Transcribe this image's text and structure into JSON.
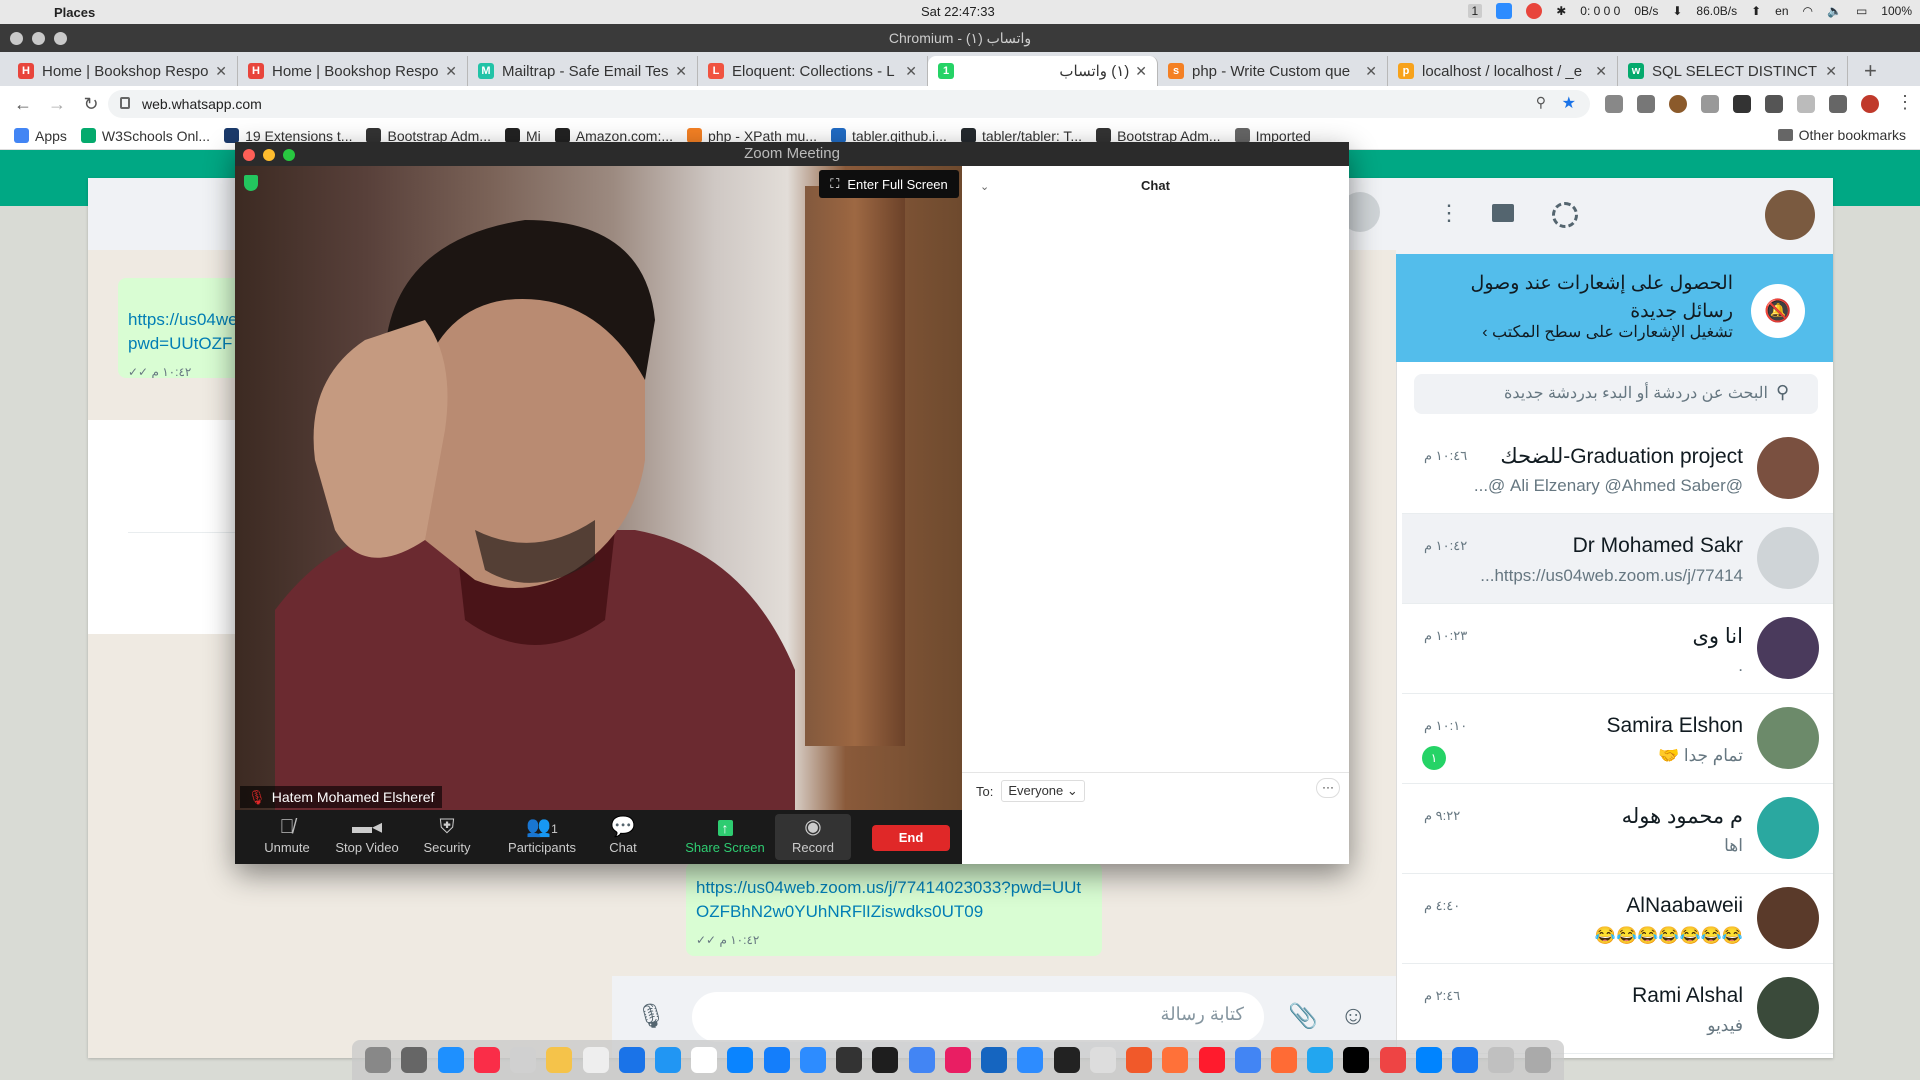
{
  "menubar": {
    "app_name": "Places",
    "clock": "Sat 22:47:33",
    "net_down": "0B/s",
    "net_up": "86.0B/s",
    "counter": "0: 0 0 0",
    "lang": "en",
    "battery": "100%",
    "badge": "1"
  },
  "browser": {
    "window_title": "Chromium - واتساب (١)",
    "tabs": [
      {
        "label": "Home | Bookshop Respo",
        "color": "#e8453c",
        "glyph": "H"
      },
      {
        "label": "Home | Bookshop Respo",
        "color": "#e8453c",
        "glyph": "H"
      },
      {
        "label": "Mailtrap - Safe Email Tes",
        "color": "#22c3a7",
        "glyph": "M"
      },
      {
        "label": "Eloquent: Collections - L",
        "color": "#f05340",
        "glyph": "L"
      },
      {
        "label": "(١) واتساب",
        "color": "#25d366",
        "glyph": "1"
      },
      {
        "label": "php - Write Custom que",
        "color": "#f48024",
        "glyph": "s"
      },
      {
        "label": "localhost / localhost / _e",
        "color": "#f7a21b",
        "glyph": "p"
      },
      {
        "label": "SQL SELECT DISTINCT S",
        "color": "#04aa6d",
        "glyph": "w"
      }
    ],
    "url": "web.whatsapp.com",
    "bookmarks": [
      {
        "label": "Apps",
        "color": "#4285f4"
      },
      {
        "label": "W3Schools Onl...",
        "color": "#04aa6d"
      },
      {
        "label": "19 Extensions t...",
        "color": "#1b3a6b"
      },
      {
        "label": "Bootstrap Adm...",
        "color": "#333333"
      },
      {
        "label": "Mi",
        "color": "#222222"
      },
      {
        "label": "Amazon.com:...",
        "color": "#222222"
      },
      {
        "label": "php - XPath mu...",
        "color": "#f48024"
      },
      {
        "label": "tabler.github.i...",
        "color": "#206bc4"
      },
      {
        "label": "tabler/tabler: T...",
        "color": "#24292e"
      },
      {
        "label": "Bootstrap Adm...",
        "color": "#333333"
      },
      {
        "label": "Imported",
        "color": "#666666"
      }
    ],
    "other_bookmarks": "Other bookmarks"
  },
  "zoom": {
    "title": "Zoom Meeting",
    "fullscreen_label": "Enter Full Screen",
    "participant_name": "Hatem Mohamed Elsheref",
    "toolbar": {
      "unmute": "Unmute",
      "stop_video": "Stop Video",
      "security": "Security",
      "participants": "Participants",
      "participants_count": "1",
      "chat": "Chat",
      "share_screen": "Share Screen",
      "record": "Record",
      "end": "End"
    },
    "chat_panel": {
      "title": "Chat",
      "to_label": "To:",
      "to_value": "Everyone",
      "more": "···"
    }
  },
  "whatsapp": {
    "notification": {
      "title": "الحصول على إشعارات عند وصول رسائل جديدة",
      "action": "تشغيل الإشعارات على سطح المكتب ›"
    },
    "search_placeholder": "البحث عن دردشة أو البدء بدردشة جديدة",
    "chats": [
      {
        "name": "Graduation project-للضحك",
        "time": "١٠:٤٦ م",
        "last": "@Ali Elzenary @Ahmed Saber @...",
        "avatar": "#7a5040",
        "selected": false
      },
      {
        "name": "Dr Mohamed Sakr",
        "time": "١٠:٤٢ م",
        "last": "https://us04web.zoom.us/j/77414...",
        "avatar": "#cfd4d7",
        "selected": true
      },
      {
        "name": "انا وى",
        "time": "١٠:٢٣ م",
        "last": ".",
        "avatar": "#4a3a5c",
        "selected": false
      },
      {
        "name": "Samira Elshon",
        "time": "١٠:١٠ م",
        "last": "تمام جدا 🤝",
        "avatar": "#6c8a6a",
        "selected": false,
        "unread": "١"
      },
      {
        "name": "م محمود هوله",
        "time": "٩:٢٢ م",
        "last": "اها",
        "avatar": "#2aa8a0",
        "selected": false
      },
      {
        "name": "AlNaabaweii",
        "time": "٤:٤٠ م",
        "last": "😂😂😂😂😂😂😂",
        "avatar": "#5a3a2a",
        "selected": false
      },
      {
        "name": "Rami Alshal",
        "time": "٢:٤٦ م",
        "last": "فيديو",
        "avatar": "#3a4a3a",
        "selected": false
      }
    ],
    "bubble_top": {
      "text": "https://us04we pwd=UUtOZF",
      "time": "١٠:٤٢ م"
    },
    "bubble_main": {
      "text": "https://us04web.zoom.us/j/77414023033?pwd=UUtOZFBhN2w0YUhNRFlIZiswdks0UT09",
      "time": "١٠:٤٢ م"
    },
    "composer_placeholder": "كتابة رسالة"
  }
}
